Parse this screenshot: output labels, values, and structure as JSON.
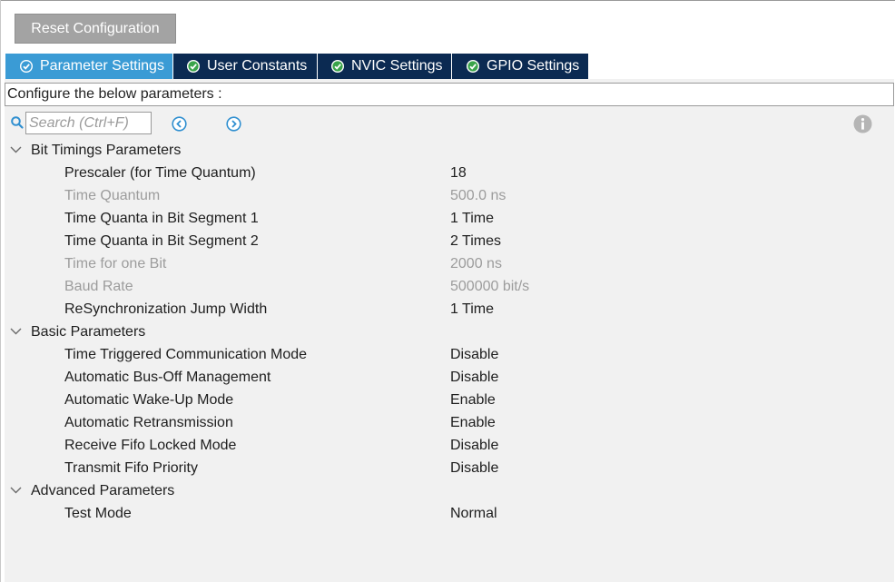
{
  "toolbar": {
    "reset_label": "Reset Configuration"
  },
  "tabs": [
    {
      "label": "Parameter Settings",
      "active": true
    },
    {
      "label": "User Constants",
      "active": false
    },
    {
      "label": "NVIC Settings",
      "active": false
    },
    {
      "label": "GPIO Settings",
      "active": false
    }
  ],
  "configure_text": "Configure the below parameters :",
  "search": {
    "placeholder": "Search (Ctrl+F)",
    "value": ""
  },
  "colors": {
    "tab_active": "#3a9bd5",
    "tab_inactive": "#0b2a52",
    "check_green": "#3aa44a",
    "nav_blue": "#2f8fd0",
    "readonly_text": "#9c9c9c"
  },
  "groups": [
    {
      "label": "Bit Timings Parameters",
      "params": [
        {
          "name": "Prescaler (for Time Quantum)",
          "value": "18",
          "readonly": false
        },
        {
          "name": "Time Quantum",
          "value": "500.0 ns",
          "readonly": true
        },
        {
          "name": "Time Quanta in Bit Segment 1",
          "value": "1 Time",
          "readonly": false
        },
        {
          "name": "Time Quanta in Bit Segment 2",
          "value": "2 Times",
          "readonly": false
        },
        {
          "name": "Time for one Bit",
          "value": "2000 ns",
          "readonly": true
        },
        {
          "name": "Baud Rate",
          "value": "500000 bit/s",
          "readonly": true
        },
        {
          "name": "ReSynchronization Jump Width",
          "value": "1 Time",
          "readonly": false
        }
      ]
    },
    {
      "label": "Basic Parameters",
      "params": [
        {
          "name": "Time Triggered Communication Mode",
          "value": "Disable",
          "readonly": false
        },
        {
          "name": "Automatic Bus-Off Management",
          "value": "Disable",
          "readonly": false
        },
        {
          "name": "Automatic Wake-Up Mode",
          "value": "Enable",
          "readonly": false
        },
        {
          "name": "Automatic Retransmission",
          "value": "Enable",
          "readonly": false
        },
        {
          "name": "Receive Fifo Locked Mode",
          "value": "Disable",
          "readonly": false
        },
        {
          "name": "Transmit Fifo Priority",
          "value": "Disable",
          "readonly": false
        }
      ]
    },
    {
      "label": "Advanced Parameters",
      "params": [
        {
          "name": "Test Mode",
          "value": "Normal",
          "readonly": false
        }
      ]
    }
  ]
}
